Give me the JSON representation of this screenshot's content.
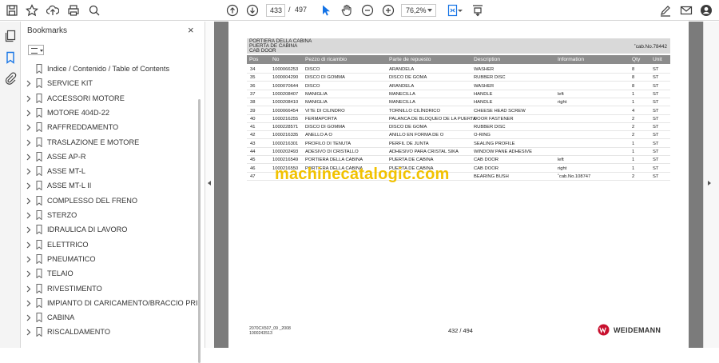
{
  "toolbar": {
    "icons": [
      "save-icon",
      "bookmark-star-icon",
      "upload-icon",
      "print-icon",
      "zoom-search-icon",
      "prev-page-icon",
      "next-page-icon",
      "select-cursor-icon",
      "hand-icon",
      "zoom-out-icon",
      "zoom-in-icon",
      "fit-page-icon",
      "scroll-mode-icon",
      "edit-sign-icon",
      "mail-icon",
      "account-icon"
    ],
    "current_page": "433",
    "page_separator": "/",
    "total_pages": "497",
    "zoom": "76,2%"
  },
  "sidebar": {
    "title": "Bookmarks",
    "close": "×",
    "items": [
      {
        "label": "Indice / Contenido / Table of Contents",
        "expandable": false
      },
      {
        "label": "SERVICE KIT",
        "expandable": true
      },
      {
        "label": "ACCESSORI MOTORE",
        "expandable": true
      },
      {
        "label": "MOTORE 404D-22",
        "expandable": true
      },
      {
        "label": "RAFFREDDAMENTO",
        "expandable": true
      },
      {
        "label": "TRASLAZIONE E MOTORE",
        "expandable": true
      },
      {
        "label": "ASSE AP-R",
        "expandable": true
      },
      {
        "label": "ASSE MT-L",
        "expandable": true
      },
      {
        "label": "ASSE MT-L II",
        "expandable": true
      },
      {
        "label": "COMPLESSO DEL FRENO",
        "expandable": true
      },
      {
        "label": "STERZO",
        "expandable": true
      },
      {
        "label": "IDRAULICA DI LAVORO",
        "expandable": true
      },
      {
        "label": "ELETTRICO",
        "expandable": true
      },
      {
        "label": "PNEUMATICO",
        "expandable": true
      },
      {
        "label": "TELAIO",
        "expandable": true
      },
      {
        "label": "RIVESTIMENTO",
        "expandable": true
      },
      {
        "label": "IMPIANTO DI CARICAMENTO/BRACCIO PRINCIPA",
        "expandable": true
      },
      {
        "label": "CABINA",
        "expandable": true
      },
      {
        "label": "RISCALDAMENTO",
        "expandable": true
      }
    ]
  },
  "document": {
    "header_lines": [
      "PORTIERA DELLA CABINA",
      "PUERTA DE CABINA",
      "CAB DOOR"
    ],
    "header_ref": "˚cab.No.78442",
    "columns": [
      "Pos",
      "No",
      "Pezzo di ricambio",
      "Parte de repuesto",
      "Description",
      "Information",
      "Qty",
      "Unit"
    ],
    "rows": [
      [
        "34",
        "1000066253",
        "DISCO",
        "ARANDELA",
        "WASHER",
        "",
        "8",
        "ST"
      ],
      [
        "35",
        "1000004290",
        "DISCO DI GOMMA",
        "DISCO DE GOMA",
        "RUBBER DISC",
        "",
        "8",
        "ST"
      ],
      [
        "36",
        "1000070644",
        "DISCO",
        "ARANDELA",
        "WASHER",
        "",
        "8",
        "ST"
      ],
      [
        "37",
        "1000208407",
        "MANIGLIA",
        "MANECILLA",
        "HANDLE",
        "left",
        "1",
        "ST"
      ],
      [
        "38",
        "1000208410",
        "MANIGLIA",
        "MANECILLA",
        "HANDLE",
        "right",
        "1",
        "ST"
      ],
      [
        "39",
        "1000066454",
        "VITE DI CILINDRO",
        "TORNILLO CILÍNDRICO",
        "CHEESE HEAD SCREW",
        "",
        "4",
        "ST"
      ],
      [
        "40",
        "1000216255",
        "FERMAPORTA",
        "PALANCA DE BLOQUEO DE LA PUERTA",
        "DOOR FASTENER",
        "",
        "2",
        "ST"
      ],
      [
        "41",
        "1000228571",
        "DISCO DI GOMMA",
        "DISCO DE GOMA",
        "RUBBER DISC",
        "",
        "2",
        "ST"
      ],
      [
        "42",
        "1000216335",
        "ANELLO A O",
        "ANILLO EN FORMA DE O",
        "O-RING",
        "",
        "2",
        "ST"
      ],
      [
        "43",
        "1000216301",
        "PROFILO DI TENUTA",
        "PERFIL DE JUNTA",
        "SEALING PROFILE",
        "",
        "1",
        "ST"
      ],
      [
        "44",
        "1000202493",
        "ADESIVO DI CRISTALLO",
        "ADHESIVO PARA CRISTAL SIKA",
        "WINDOW PANE ADHESIVE",
        "",
        "1",
        "ST"
      ],
      [
        "45",
        "1000216549",
        "PORTIERA DELLA CABINA",
        "PUERTA DE CABINA",
        "CAB DOOR",
        "left",
        "1",
        "ST"
      ],
      [
        "46",
        "1000216550",
        "PORTIERA DELLA CABINA",
        "PUERTA DE CABINA",
        "CAB DOOR",
        "right",
        "1",
        "ST"
      ],
      [
        "47",
        "",
        "",
        "",
        "BEARING BUSH",
        "˚cab.No.108747",
        "2",
        "ST"
      ]
    ],
    "watermark": "machinecatalogic.com",
    "footer_doc_lines": [
      "2070CX507_09 _2008",
      "1000243513"
    ],
    "footer_page": "432 / 494",
    "brand": "WEIDEMANN",
    "brand_color": "#c8102e"
  }
}
